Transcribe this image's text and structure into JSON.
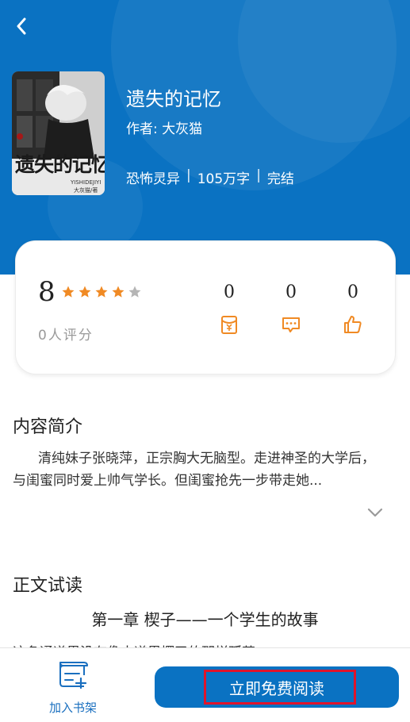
{
  "header": {
    "back_icon": "chevron-left-icon"
  },
  "book": {
    "title": "遗失的记忆",
    "author": "作者: 大灰猫",
    "genre": "恐怖灵异",
    "word_count": "105万字",
    "status": "完结",
    "separator": "|",
    "cover": {
      "title": "遗失的记忆",
      "subtitle": "YISHIDEJIYI",
      "author": "大灰猫/著"
    }
  },
  "rating": {
    "score": "8",
    "stars_filled": 4,
    "stars_total": 5,
    "count_text": "0人评分",
    "star_color": "#f08a24",
    "stats": [
      {
        "value": "0",
        "icon": "red-envelope-icon"
      },
      {
        "value": "0",
        "icon": "comment-icon"
      },
      {
        "value": "0",
        "icon": "thumbs-up-icon"
      }
    ]
  },
  "intro": {
    "heading": "内容简介",
    "text": "清纯妹子张晓萍，正宗胸大无脑型。走进神圣的大学后，与闺蜜同时爱上帅气学长。但闺蜜抢先一步带走她...",
    "expand_icon": "chevron-down-icon"
  },
  "trial": {
    "heading": "正文试读",
    "chapter_title": "第一章 楔子——一个学生的故事",
    "first_line": "这条通道里没有像大道里摆了的那样孤苦"
  },
  "bottom_bar": {
    "shelf_label": "加入书架",
    "read_label": "立即免费阅读"
  },
  "colors": {
    "brand_blue": "#0a72c2",
    "accent_orange": "#f08a24",
    "highlight_red": "#e0142b"
  }
}
